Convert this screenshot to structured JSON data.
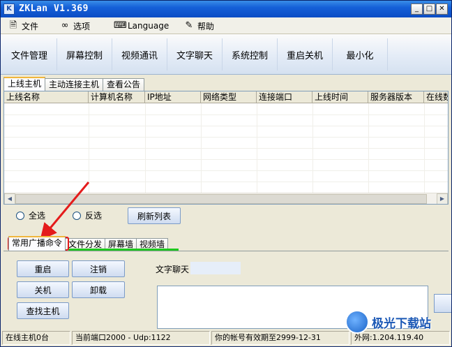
{
  "window": {
    "title": "ZKLan V1.369",
    "app_icon": "K",
    "controls": {
      "minimize": "_",
      "maximize": "□",
      "close": "✕"
    }
  },
  "menu": [
    {
      "label": "文件",
      "icon": "file-icon"
    },
    {
      "label": "选项",
      "icon": "glasses-icon"
    },
    {
      "label": "Language",
      "icon": "language-icon"
    },
    {
      "label": "帮助",
      "icon": "help-icon"
    }
  ],
  "toolbar": [
    "文件管理",
    "屏幕控制",
    "视频通讯",
    "文字聊天",
    "系统控制",
    "重启关机",
    "最小化"
  ],
  "tabs": [
    "上线主机",
    "主动连接主机",
    "查看公告"
  ],
  "grid": {
    "columns": [
      "上线名称",
      "计算机名称",
      "IP地址",
      "网络类型",
      "连接端口",
      "上线时间",
      "服务器版本",
      "在线数"
    ],
    "rows": []
  },
  "selection": {
    "select_all": "全选",
    "invert": "反选",
    "refresh": "刷新列表"
  },
  "lower_tabs": [
    "常用广播命令",
    "文件分发",
    "屏幕墙",
    "视频墙"
  ],
  "commands": {
    "restart": "重启",
    "logout": "注销",
    "shutdown": "关机",
    "uninstall": "卸载",
    "find_host": "查找主机"
  },
  "chat": {
    "label": "文字聊天"
  },
  "statusbar": {
    "online": "在线主机0台",
    "port": "当前端口2000 - Udp:1122",
    "expiry": "你的帐号有效期至2999-12-31",
    "wan": "外网:1.204.119.40"
  },
  "watermark": {
    "text": "极光下载站"
  },
  "colors": {
    "titlebar": "#0b4cc4",
    "annotation": "#e41b1b",
    "highlight": "#1ec81e"
  }
}
